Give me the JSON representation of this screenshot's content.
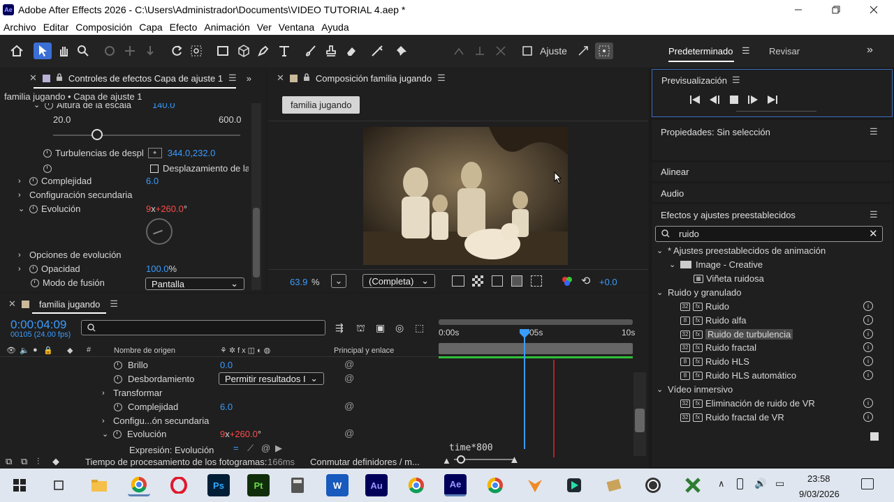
{
  "window": {
    "title": "Adobe After Effects 2026 - C:\\Users\\Administrador\\Documents\\VIDEO TUTORIAL 4.aep *",
    "app_badge": "Ae"
  },
  "menu": [
    "Archivo",
    "Editar",
    "Composición",
    "Capa",
    "Efecto",
    "Animación",
    "Ver",
    "Ventana",
    "Ayuda"
  ],
  "toolbar": {
    "snap_label": "Ajuste"
  },
  "workspace": {
    "active": "Predeterminado",
    "other": "Revisar"
  },
  "effect_controls": {
    "tab": "Controles de efectos Capa de ajuste 1",
    "layer_path": "familia jugando • Capa de ajuste 1",
    "rows": {
      "scale_height_label": "Altura de la escala",
      "scale_height_value": "140.0",
      "slider_min": "20.0",
      "slider_max": "600.0",
      "turb_label": "Turbulencias de despl",
      "turb_value_a": "344.0",
      "turb_value_b": ",232.0",
      "pin_label": "Desplazamiento de la",
      "complexity_label": "Complejidad",
      "complexity_value": "6.0",
      "secondary_label": "Configuración secundaria",
      "evolution_label": "Evolución",
      "evolution_rev": "9",
      "evolution_x": "x",
      "evolution_deg": "+260.0",
      "evolution_unit": "°",
      "evo_options_label": "Opciones de evolución",
      "opacity_label": "Opacidad",
      "opacity_value": "100.0",
      "opacity_unit": "%",
      "blend_label": "Modo de fusión",
      "blend_value": "Pantalla"
    }
  },
  "composition": {
    "tab": "Composición familia jugando",
    "chip": "familia jugando",
    "zoom": "63.9",
    "zoom_unit": "%",
    "resolution": "(Completa)",
    "exposure": "+0.0"
  },
  "right_panels": {
    "preview_title": "Previsualización",
    "properties_title": "Propiedades: Sin selección",
    "align_title": "Alinear",
    "audio_title": "Audio",
    "effects_title": "Efectos y ajustes preestablecidos",
    "search_value": "ruido",
    "tree": [
      "* Ajustes preestablecidos de animación",
      "Image - Creative",
      "Viñeta ruidosa",
      "Ruido y granulado",
      "Ruido",
      "Ruido alfa",
      "Ruido de turbulencia",
      "Ruido fractal",
      "Ruido HLS",
      "Ruido HLS automático",
      "Vídeo inmersivo",
      "Eliminación de ruido de VR",
      "Ruido fractal de VR"
    ]
  },
  "timeline": {
    "tab": "familia jugando",
    "timecode": "0:00:04:09",
    "frames": "00105 (24.00 fps)",
    "col_hash": "#",
    "col_source": "Nombre de origen",
    "col_parent": "Principal y enlace",
    "ruler": [
      "0:00s",
      "05s",
      "10s"
    ],
    "rows": {
      "brightness_label": "Brillo",
      "brightness_value": "0.0",
      "overflow_label": "Desbordamiento",
      "overflow_value": "Permitir resultados I",
      "transform_label": "Transformar",
      "complexity_label": "Complejidad",
      "complexity_value": "6.0",
      "secondary_label": "Configu...ón secundaria",
      "evolution_label": "Evolución",
      "evolution_rev": "9",
      "evolution_x": "x",
      "evolution_deg": "+260.0",
      "evolution_unit": "°",
      "expression_label": "Expresión: Evolución",
      "expression_code": "time*800"
    },
    "footer_time_label": "Tiempo de procesamiento de los fotogramas:",
    "footer_time_value": "166ms",
    "footer_toggle": "Conmutar definidores / m..."
  },
  "taskbar": {
    "time": "23:58",
    "date": "9/03/2026",
    "apps": [
      "Ps",
      "Pt",
      "Au",
      "Ae"
    ]
  },
  "colors": {
    "accent_blue": "#3a9cff",
    "value_red": "#ff4b4b",
    "ae_badge": "#00005b",
    "timeline_green": "#2fbf3a"
  }
}
